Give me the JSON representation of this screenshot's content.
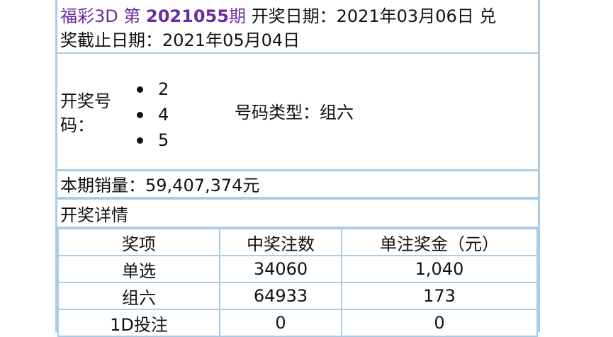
{
  "header": {
    "lottery": "福彩3D",
    "di": "第",
    "issue": "2021055",
    "qi": "期",
    "draw_date_label": "开奖日期：",
    "draw_date": "2021年03月06日",
    "line1_tail": "兑",
    "line2_prefix": "奖截止日期：",
    "expire_date": "2021年05月04日"
  },
  "draw": {
    "numbers_label": "开奖号码：",
    "numbers": [
      "2",
      "4",
      "5"
    ],
    "type_label": "号码类型：",
    "type": "组六"
  },
  "sales": {
    "label": "本期销量：",
    "value": "59,407,374元"
  },
  "details": {
    "title": "开奖详情",
    "columns": [
      "奖项",
      "中奖注数",
      "单注奖金（元）"
    ],
    "rows": [
      [
        "单选",
        "34060",
        "1,040"
      ],
      [
        "组六",
        "64933",
        "173"
      ],
      [
        "1D投注",
        "0",
        "0"
      ]
    ]
  },
  "colors": {
    "border": "#a9cde8",
    "accent": "#6b2ca0"
  }
}
